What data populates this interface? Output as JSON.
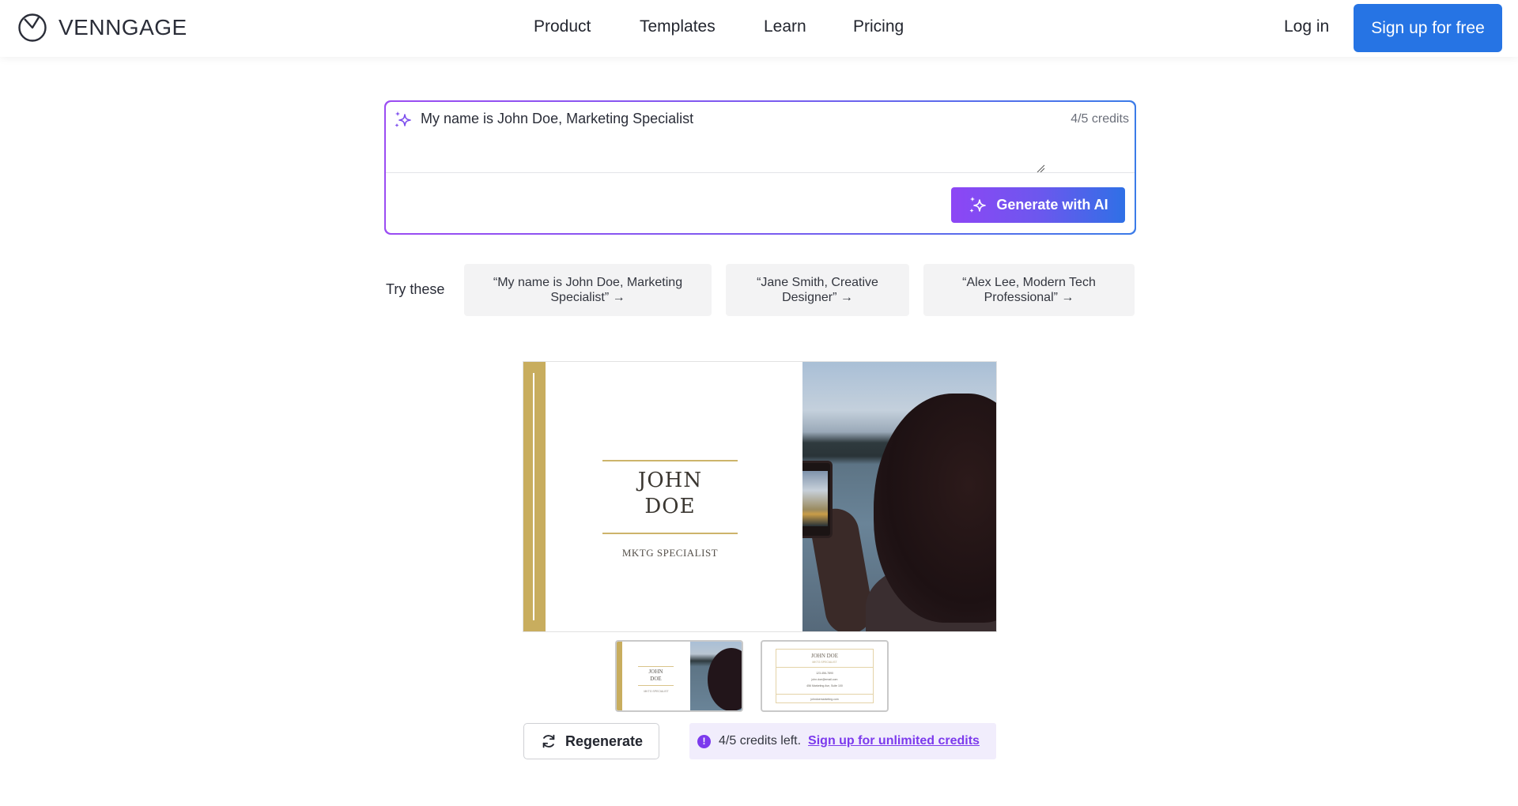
{
  "header": {
    "logo_text": "VENNGAGE",
    "nav": [
      {
        "label": "Product"
      },
      {
        "label": "Templates"
      },
      {
        "label": "Learn"
      },
      {
        "label": "Pricing"
      }
    ],
    "login_label": "Log in",
    "signup_label": "Sign up for free",
    "signup_color": "#2674e4"
  },
  "prompt": {
    "value": "My name is John Doe, Marketing Specialist",
    "credits": "4/5 credits",
    "generate_label": "Generate with AI"
  },
  "suggestions": {
    "label": "Try these",
    "items": [
      {
        "text": "“My name is John Doe, Marketing Specialist” →"
      },
      {
        "text": "“Jane Smith, Creative Designer” →"
      },
      {
        "text": "“Alex Lee, Modern Tech Professional” →"
      }
    ]
  },
  "preview": {
    "name_line1": "JOHN",
    "name_line2": "DOE",
    "title": "MKTG SPECIALIST",
    "accent_color": "#c8ad5e"
  },
  "thumbnails": [
    {
      "name_line1": "JOHN",
      "name_line2": "DOE",
      "title": "MKTG SPECIALIST"
    },
    {
      "name": "JOHN DOE",
      "title": "MKTG SPECIALIST",
      "phone": "123-456-7890",
      "email": "john.doe@email.com",
      "address": "456 Marketing Ave, Suite 100",
      "website": "johndoemarketing.com"
    }
  ],
  "actions": {
    "regenerate_label": "Regenerate",
    "credits_left": "4/5 credits left.",
    "signup_link": "Sign up for unlimited credits",
    "alert_glyph": "!"
  }
}
